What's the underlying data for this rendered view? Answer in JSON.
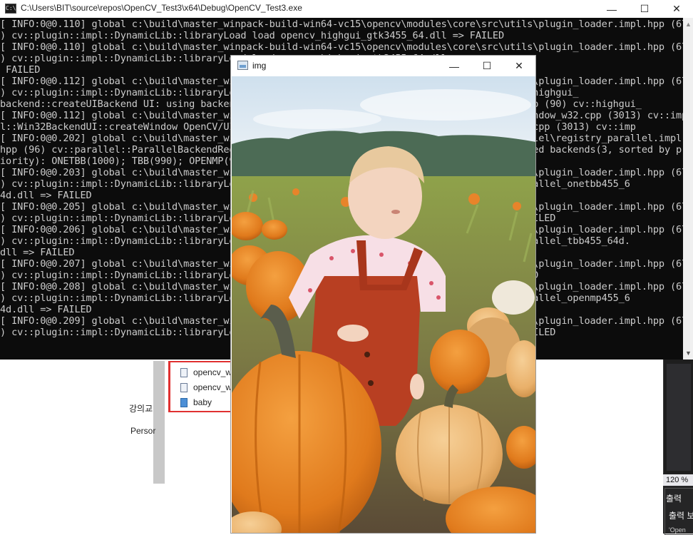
{
  "console": {
    "title": "C:\\Users\\BIT\\source\\repos\\OpenCV_Test3\\x64\\Debug\\OpenCV_Test3.exe",
    "icon": "console-app-icon",
    "lines": [
      "[ INFO:0@0.110] global c:\\build\\master_winpack-build-win64-vc15\\opencv\\modules\\core\\src\\utils\\plugin_loader.impl.hpp (67",
      ") cv::plugin::impl::DynamicLib::libraryLoad load opencv_highgui_gtk3455_64.dll => FAILED",
      "[ INFO:0@0.110] global c:\\build\\master_winpack-build-win64-vc15\\opencv\\modules\\core\\src\\utils\\plugin_loader.impl.hpp (67",
      ") cv::plugin::impl::DynamicLib::libraryLoad load opencv_highgui_gtk2455_64.dll =>",
      " FAILED",
      "[ INFO:0@0.112] global c:\\build\\master_winpack-build-win64-vc15\\opencv\\modules\\core\\src\\utils\\plugin_loader.impl.hpp (67",
      ") cv::plugin::impl::DynamicLib::libraryLoad load opencv_highgui_builtin_backend.cpp (90) cv::highgui_",
      "backend::createUIBackend UI: using backend: WIN32 (priority=970)                   backend.cpp (90) cv::highgui_",
      "[ INFO:0@0.112] global c:\\build\\master_winpack-build-win64-vc15\\opencv\\modules\\highgui\\src\\window_w32.cpp (3013) cv::imp",
      "l::Win32BackendUI::createWindow OpenCV/UI: Creating Win32UI window: img (1)       window_w32.cpp (3013) cv::imp",
      "[ INFO:0@0.202] global c:\\build\\master_winpack-build-win64-vc15\\opencv\\modules\\core\\src\\parallel\\registry_parallel.impl.",
      "hpp (96) cv::parallel::ParallelBackendRegistry::ParallelBackendRegistry core(parallel): Enabled backends(3, sorted by pr",
      "iority): ONETBB(1000); TBB(990); OPENMP(980)",
      "[ INFO:0@0.203] global c:\\build\\master_winpack-build-win64-vc15\\opencv\\modules\\core\\src\\utils\\plugin_loader.impl.hpp (67",
      ") cv::plugin::impl::DynamicLib::libraryLoad load c:\\opencv\\build\\x64\\vc15\\bin\\opencv_core_parallel_onetbb455_6",
      "4d.dll => FAILED",
      "[ INFO:0@0.205] global c:\\build\\master_winpack-build-win64-vc15\\opencv\\modules\\core\\src\\utils\\plugin_loader.impl.hpp (67",
      ") cv::plugin::impl::DynamicLib::libraryLoad load opencv_core_parallel_onetbb455_64d.dll => FAILED",
      "[ INFO:0@0.206] global c:\\build\\master_winpack-build-win64-vc15\\opencv\\modules\\core\\src\\utils\\plugin_loader.impl.hpp (67",
      ") cv::plugin::impl::DynamicLib::libraryLoad load c:\\opencv\\build\\x64\\vc15\\bin\\opencv_core_parallel_tbb455_64d.",
      "dll => FAILED",
      "[ INFO:0@0.207] global c:\\build\\master_winpack-build-win64-vc15\\opencv\\modules\\core\\src\\utils\\plugin_loader.impl.hpp (67",
      ") cv::plugin::impl::DynamicLib::libraryLoad load opencv_core_parallel_tbb455_64d.dll => FAILED",
      "[ INFO:0@0.208] global c:\\build\\master_winpack-build-win64-vc15\\opencv\\modules\\core\\src\\utils\\plugin_loader.impl.hpp (67",
      ") cv::plugin::impl::DynamicLib::libraryLoad load c:\\opencv\\build\\x64\\vc15\\bin\\opencv_core_parallel_openmp455_6",
      "4d.dll => FAILED",
      "[ INFO:0@0.209] global c:\\build\\master_winpack-build-win64-vc15\\opencv\\modules\\core\\src\\utils\\plugin_loader.impl.hpp (67",
      ") cv::plugin::impl::DynamicLib::libraryLoad load opencv_core_parallel_openmp455_64d.dll => FAILED"
    ]
  },
  "image_window": {
    "title": "img",
    "photo_description_icon": "photo-icon"
  },
  "window_controls": {
    "minimize": "—",
    "maximize": "☐",
    "close": "✕"
  },
  "explorer": {
    "files": [
      {
        "name": "opencv_w",
        "icon": "file-icon"
      },
      {
        "name": "opencv_w",
        "icon": "file-icon"
      },
      {
        "name": "baby",
        "icon": "image-file-icon"
      }
    ],
    "left_labels": [
      "강의교",
      "Persor"
    ]
  },
  "ide": {
    "zoom": "120 %",
    "panel_title": "출력",
    "panel_sub": "출력 보",
    "panel_small": "'Open"
  }
}
